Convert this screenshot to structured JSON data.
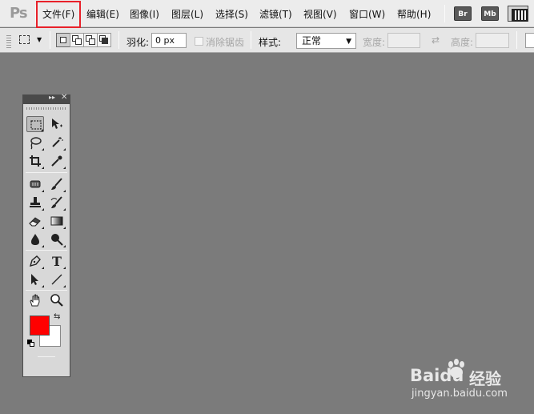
{
  "menubar": {
    "logo": "Ps",
    "items": [
      {
        "label": "文件(F)"
      },
      {
        "label": "编辑(E)"
      },
      {
        "label": "图像(I)"
      },
      {
        "label": "图层(L)"
      },
      {
        "label": "选择(S)"
      },
      {
        "label": "滤镜(T)"
      },
      {
        "label": "视图(V)"
      },
      {
        "label": "窗口(W)"
      },
      {
        "label": "帮助(H)"
      }
    ],
    "bridge_label": "Br",
    "minibridge_label": "Mb",
    "highlight_color": "#e8212a"
  },
  "options": {
    "feather_label": "羽化:",
    "feather_value": "0 px",
    "antialias_label": "消除锯齿",
    "style_label": "样式:",
    "style_value": "正常",
    "width_label": "宽度:",
    "height_label": "高度:"
  },
  "tools": {
    "colors": {
      "foreground": "#ff0000",
      "background": "#ffffff"
    },
    "icons": [
      "rectangular-marquee-icon",
      "move-icon",
      "lasso-icon",
      "magic-wand-icon",
      "crop-icon",
      "eyedropper-icon",
      "healing-brush-icon",
      "brush-icon",
      "clone-stamp-icon",
      "history-brush-icon",
      "eraser-icon",
      "gradient-icon",
      "blur-icon",
      "dodge-icon",
      "pen-icon",
      "type-icon",
      "path-selection-icon",
      "line-icon",
      "hand-icon",
      "zoom-icon"
    ],
    "type_tool_glyph": "T"
  },
  "watermark": {
    "brand": "Baidu",
    "suffix": "经验",
    "url": "jingyan.baidu.com"
  }
}
